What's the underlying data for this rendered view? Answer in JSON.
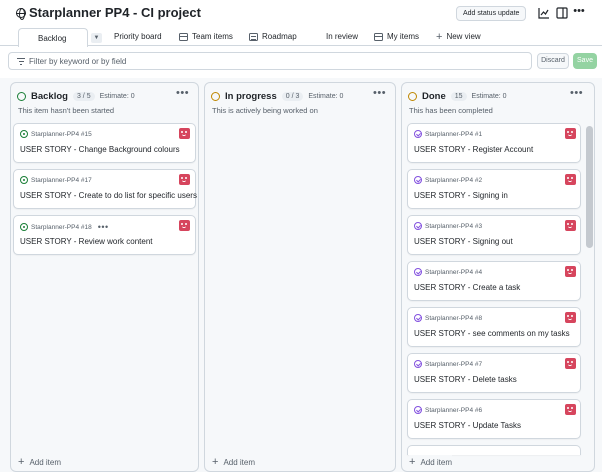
{
  "header": {
    "title": "Starplanner PP4 - CI project",
    "status_button": "Add status update"
  },
  "tabs": [
    {
      "label": "Backlog",
      "icon": "board-icon",
      "active": true
    },
    {
      "label": "Priority board",
      "icon": "board-icon"
    },
    {
      "label": "Team items",
      "icon": "table-icon"
    },
    {
      "label": "Roadmap",
      "icon": "roadmap-icon"
    },
    {
      "label": "In review",
      "icon": "board-icon"
    },
    {
      "label": "My items",
      "icon": "table-icon"
    },
    {
      "label": "New view",
      "icon": "plus-icon"
    }
  ],
  "filter": {
    "placeholder": "Filter by keyword or by field",
    "discard": "Discard",
    "save": "Save"
  },
  "colors": {
    "backlog": "#1a7f37",
    "in_progress": "#bf8700",
    "done": "#bf8700",
    "open_issue": "#1a7f37",
    "closed_issue": "#8250df",
    "avatar": "#d6455d"
  },
  "columns": [
    {
      "name": "Backlog",
      "count": "3 / 5",
      "estimate": "Estimate: 0",
      "description": "This item hasn't been started",
      "add_item": "Add item",
      "cards": [
        {
          "ref": "Starplanner-PP4 #15",
          "title": "USER STORY - Change Background colours"
        },
        {
          "ref": "Starplanner-PP4 #17",
          "title": "USER STORY - Create to do list for specific users"
        },
        {
          "ref": "Starplanner-PP4 #18",
          "title": "USER STORY - Review work content"
        }
      ]
    },
    {
      "name": "In progress",
      "count": "0 / 3",
      "estimate": "Estimate: 0",
      "description": "This is actively being worked on",
      "add_item": "Add item",
      "cards": []
    },
    {
      "name": "Done",
      "count": "15",
      "estimate": "Estimate: 0",
      "description": "This has been completed",
      "add_item": "Add item",
      "cards": [
        {
          "ref": "Starplanner-PP4 #1",
          "title": "USER STORY - Register Account"
        },
        {
          "ref": "Starplanner-PP4 #2",
          "title": "USER STORY - Signing in"
        },
        {
          "ref": "Starplanner-PP4 #3",
          "title": "USER STORY - Signing out"
        },
        {
          "ref": "Starplanner-PP4 #4",
          "title": "USER STORY - Create a task"
        },
        {
          "ref": "Starplanner-PP4 #8",
          "title": "USER STORY - see comments on my tasks"
        },
        {
          "ref": "Starplanner-PP4 #7",
          "title": "USER STORY - Delete tasks"
        },
        {
          "ref": "Starplanner-PP4 #6",
          "title": "USER STORY - Update Tasks"
        }
      ]
    }
  ]
}
